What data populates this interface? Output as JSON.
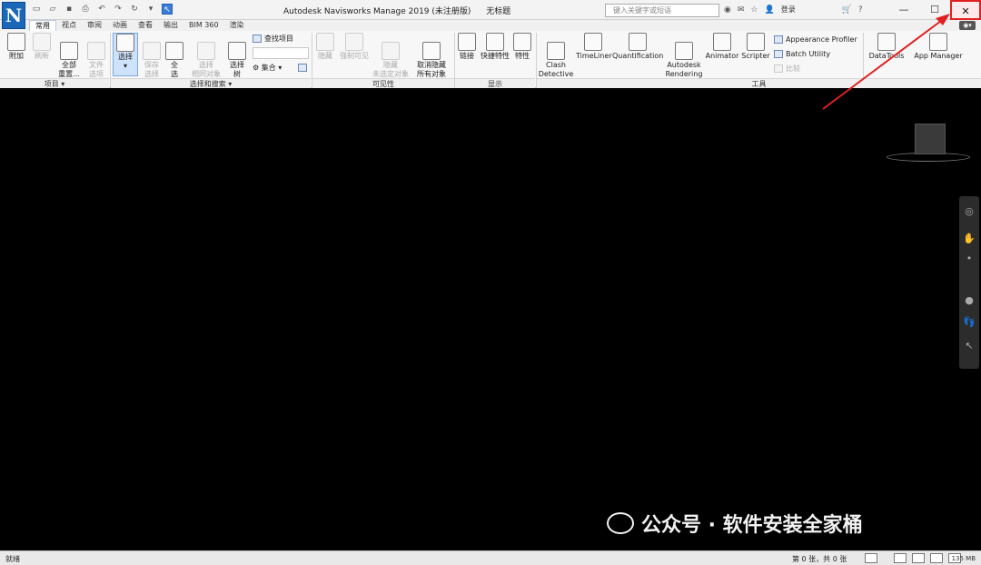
{
  "app": {
    "logo": "N",
    "title": "Autodesk Navisworks Manage 2019 (未注册版)",
    "document": "无标题",
    "search_placeholder": "键入关键字或短语",
    "login": "登录",
    "window_controls": {
      "minimize": "—",
      "maximize": "☐",
      "close": "✕"
    }
  },
  "tabs": [
    "常用",
    "视点",
    "审阅",
    "动画",
    "查看",
    "输出",
    "BIM 360",
    "渲染"
  ],
  "active_tab": "常用",
  "ribbon": {
    "project": {
      "label": "项目 ▾",
      "append": "附加",
      "refresh": "刷新",
      "reset": "全部\n重置...",
      "file_options": "文件\n选项"
    },
    "select": {
      "label": "选择和搜索 ▾",
      "select": "选择",
      "save_selection": "保存\n选择",
      "select_all": "全\n选",
      "select_same": "选择\n相同对象",
      "selection_tree": "选择\n树",
      "find_items": "查找项目",
      "quick_find": "",
      "sets": "集合"
    },
    "visibility": {
      "label": "可见性",
      "hide": "隐藏",
      "require": "强制可见",
      "hide_unselected": "隐藏\n未选定对象",
      "unhide_all": "取消隐藏\n所有对象"
    },
    "display": {
      "label": "显示",
      "links": "链接",
      "quick_properties": "快捷特性",
      "properties": "特性"
    },
    "tools": {
      "label": "工具",
      "clash": "Clash\nDetective",
      "timeliner": "TimeLiner",
      "quantification": "Quantification",
      "rendering": "Autodesk\nRendering",
      "animator": "Animator",
      "scripter": "Scripter",
      "appearance": "Appearance Profiler",
      "batch": "Batch Utility",
      "compare": "比较",
      "datatools": "DataTools",
      "appmanager": "App Manager"
    }
  },
  "watermark": "公众号 · 软件安装全家桶",
  "status": {
    "left": "就绪",
    "sheet": "第 0 张，共 0 张",
    "memory": "135 MB"
  }
}
